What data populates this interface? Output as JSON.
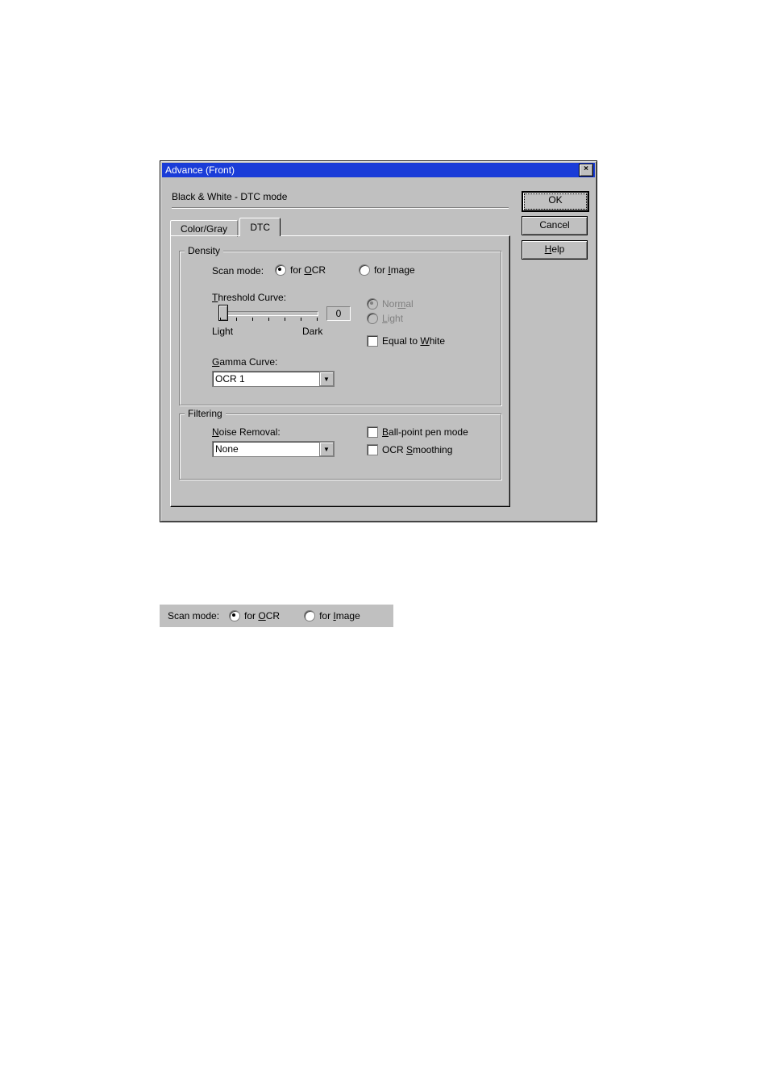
{
  "dialog": {
    "title": "Advance (Front)",
    "close_glyph": "×",
    "mode_title": "Black & White - DTC mode",
    "tabs": {
      "color_gray": "Color/Gray",
      "dtc": "DTC"
    },
    "buttons": {
      "ok": "OK",
      "cancel": "Cancel",
      "help": "Help"
    }
  },
  "density": {
    "legend": "Density",
    "scan_mode_label": "Scan mode:",
    "for_ocr": "for OCR",
    "for_image": "for Image",
    "threshold_curve_label": "Threshold Curve:",
    "threshold_value": "0",
    "slider_light": "Light",
    "slider_dark": "Dark",
    "normal": "Normal",
    "light_radio": "Light",
    "equal_to_white": "Equal to White",
    "gamma_curve_label": "Gamma Curve:",
    "gamma_value": "OCR 1"
  },
  "filtering": {
    "legend": "Filtering",
    "noise_removal_label": "Noise Removal:",
    "noise_removal_value": "None",
    "ball_point": "Ball-point pen mode",
    "ocr_smoothing": "OCR Smoothing"
  },
  "snippet": {
    "scan_mode_label": "Scan mode:",
    "for_ocr": "for OCR",
    "for_image": "for Image"
  }
}
